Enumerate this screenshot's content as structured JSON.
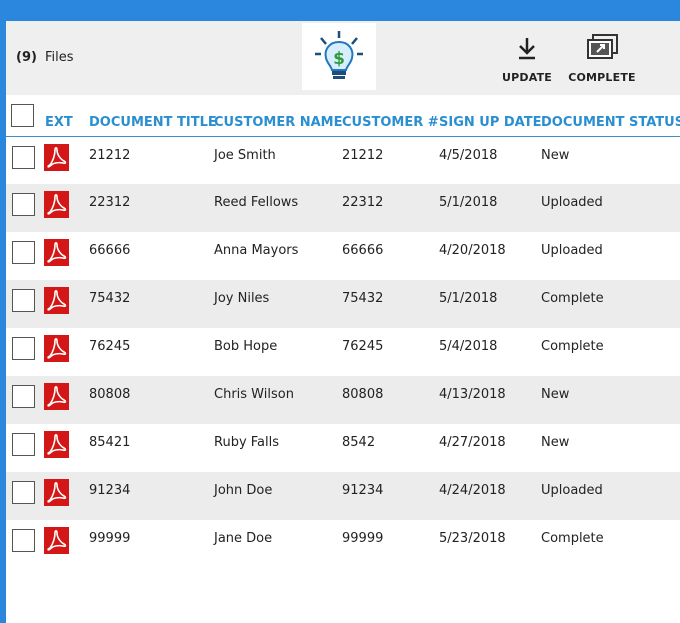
{
  "header": {
    "file_count": "(9)",
    "files_label": "Files",
    "logo_icon": "lightbulb-dollar-icon",
    "buttons": {
      "update_label": "UPDATE",
      "update_icon": "download-arrow-icon",
      "complete_label": "COMPLETE",
      "complete_icon": "stacked-images-icon"
    }
  },
  "table": {
    "columns": [
      "EXT",
      "DOCUMENT TITLE",
      "CUSTOMER NAME",
      "CUSTOMER #",
      "SIGN UP DATE",
      "DOCUMENT STATUS"
    ],
    "ext_icon": "pdf-file-icon",
    "rows": [
      {
        "title": "21212",
        "name": "Joe Smith",
        "number": "21212",
        "date": "4/5/2018",
        "status": "New"
      },
      {
        "title": "22312",
        "name": "Reed Fellows",
        "number": "22312",
        "date": "5/1/2018",
        "status": "Uploaded"
      },
      {
        "title": "66666",
        "name": "Anna Mayors",
        "number": "66666",
        "date": "4/20/2018",
        "status": "Uploaded"
      },
      {
        "title": "75432",
        "name": "Joy Niles",
        "number": "75432",
        "date": "5/1/2018",
        "status": "Complete"
      },
      {
        "title": "76245",
        "name": "Bob Hope",
        "number": "76245",
        "date": "5/4/2018",
        "status": "Complete"
      },
      {
        "title": "80808",
        "name": "Chris Wilson",
        "number": "80808",
        "date": "4/13/2018",
        "status": "New"
      },
      {
        "title": "85421",
        "name": "Ruby Falls",
        "number": "8542",
        "date": "4/27/2018",
        "status": "New"
      },
      {
        "title": "91234",
        "name": "John Doe",
        "number": "91234",
        "date": "4/24/2018",
        "status": "Uploaded"
      },
      {
        "title": "99999",
        "name": "Jane Doe",
        "number": "99999",
        "date": "5/23/2018",
        "status": "Complete"
      }
    ]
  },
  "colors": {
    "accent": "#2b86de",
    "header_text": "#2a8fd0",
    "pdf_red": "#d31616",
    "row_alt": "#ececec"
  }
}
